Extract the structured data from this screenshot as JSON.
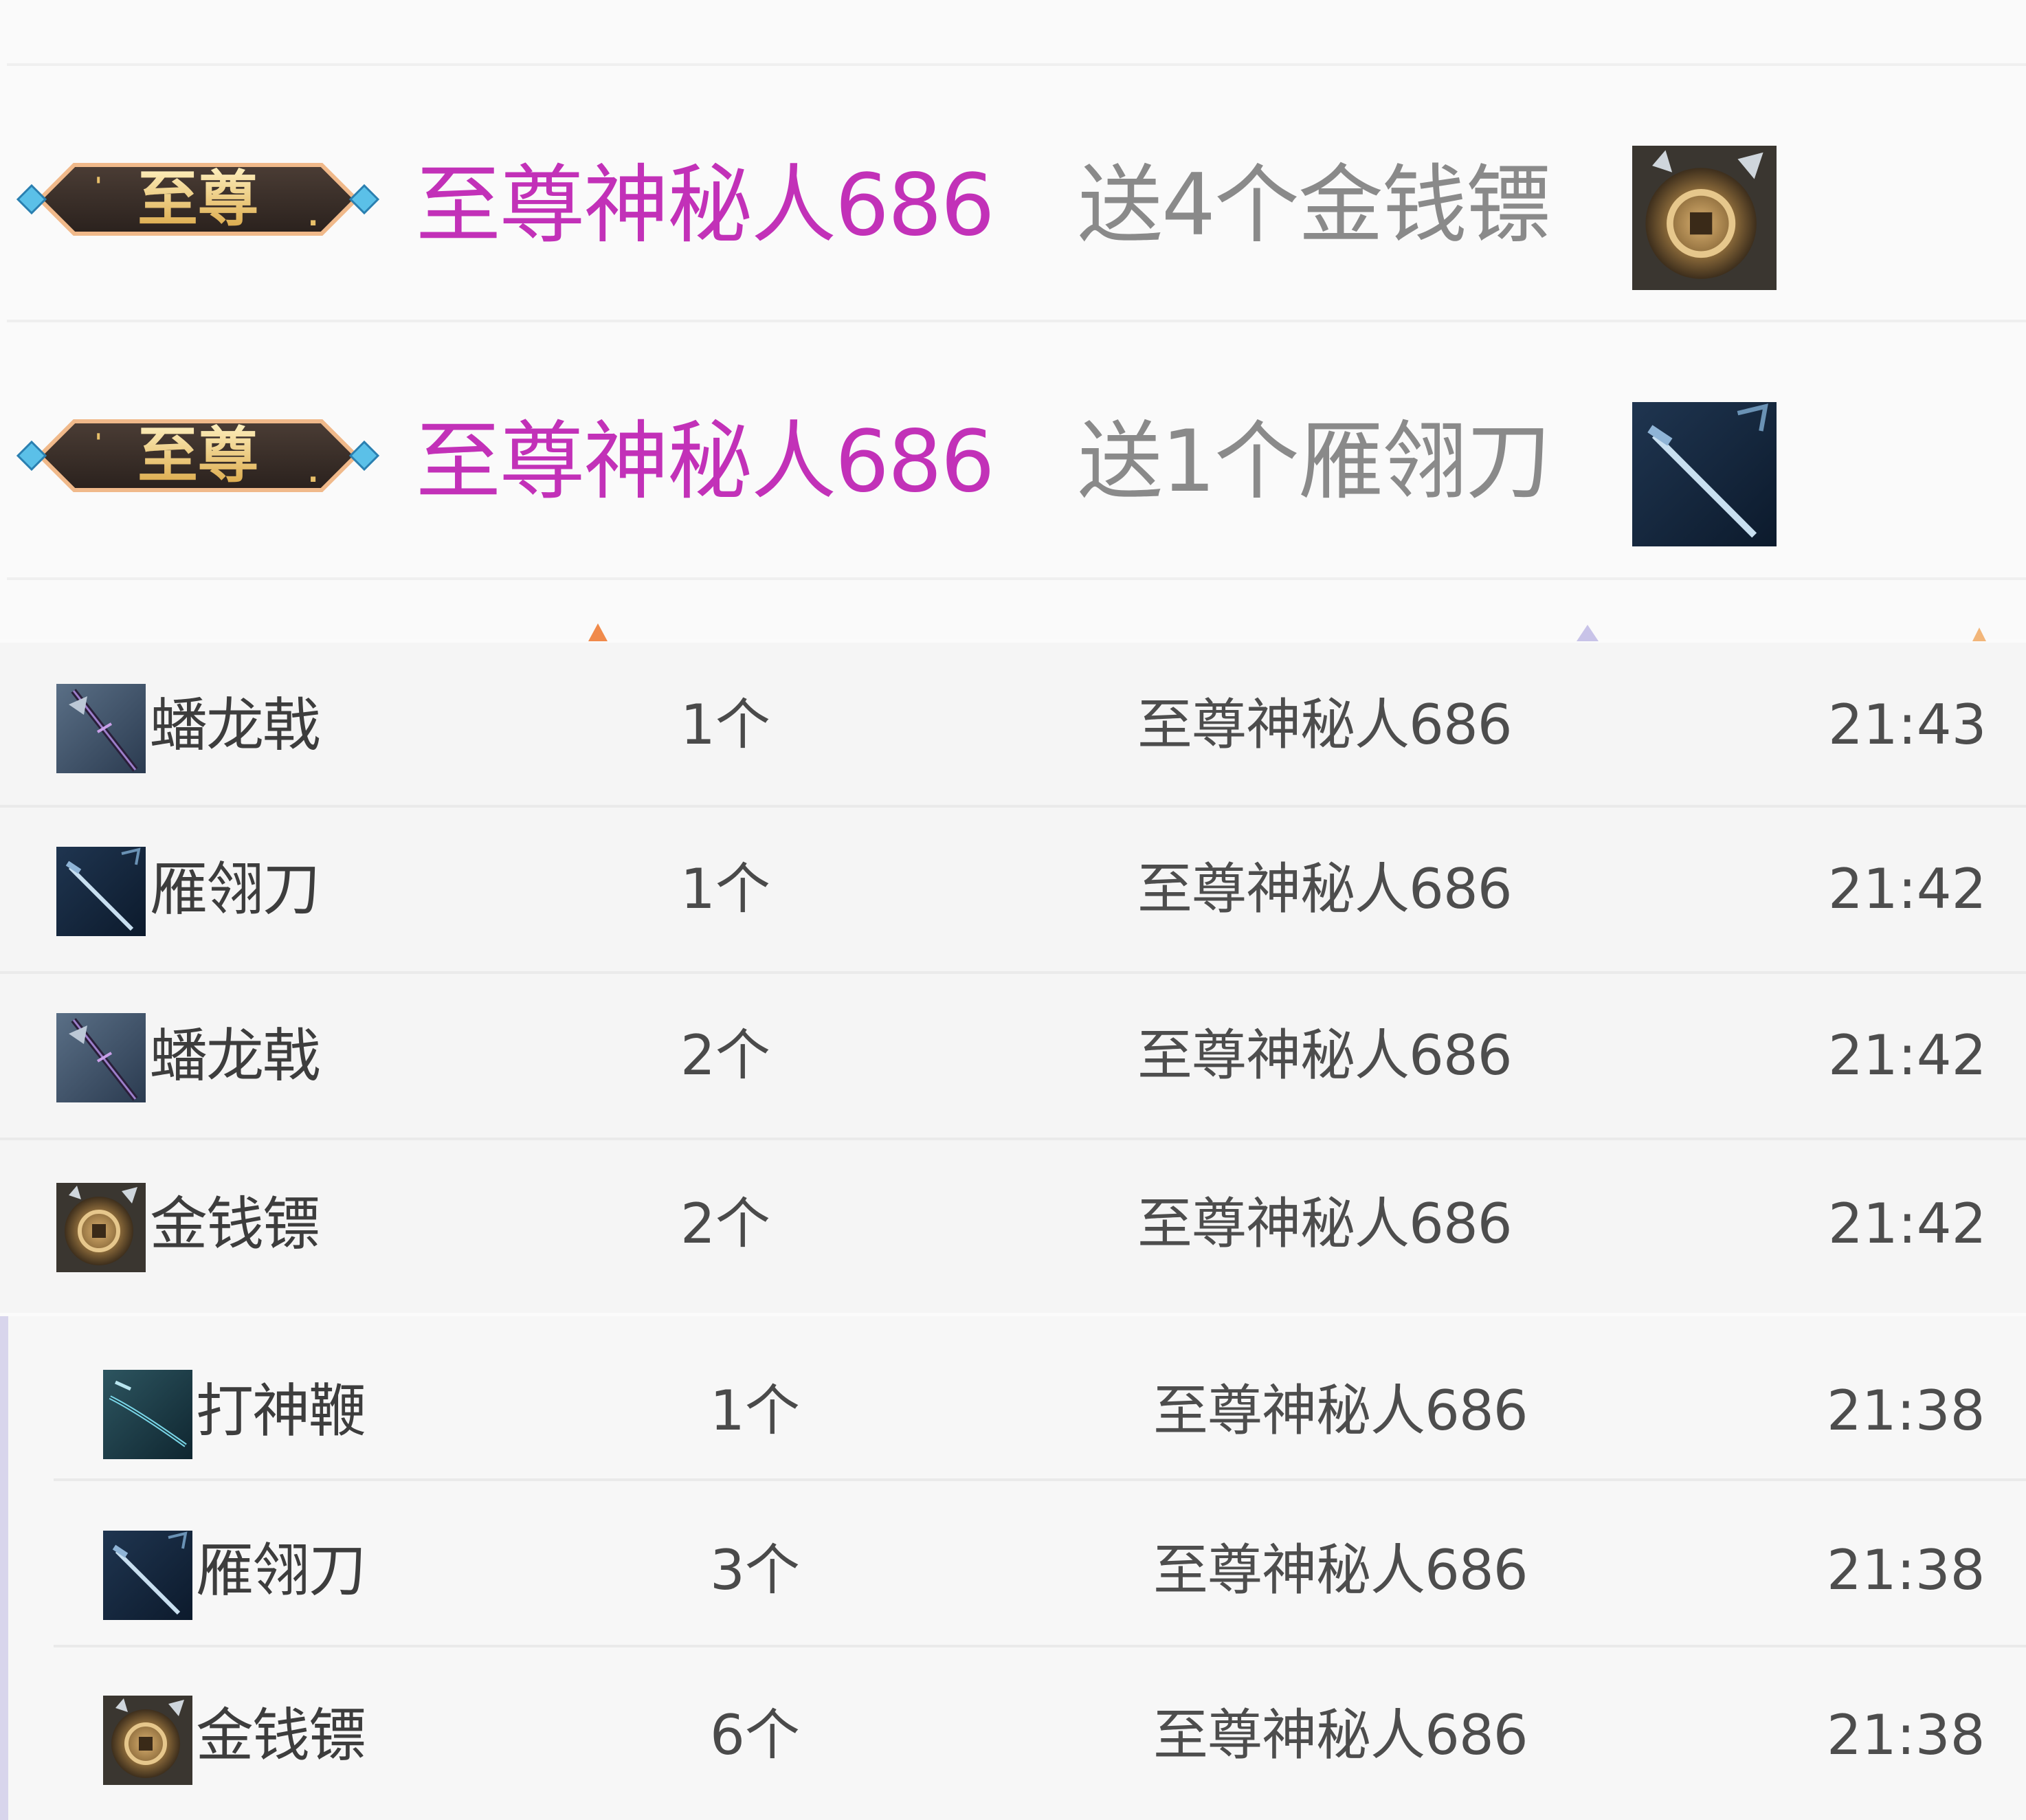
{
  "chat": {
    "messages": [
      {
        "badge": "至尊",
        "user": "至尊神秘人686",
        "action": "送4个金钱镖",
        "icon": "coin-dart-icon"
      },
      {
        "badge": "至尊",
        "user": "至尊神秘人686",
        "action": "送1个雁翎刀",
        "icon": "saber-icon"
      }
    ]
  },
  "gifts": [
    {
      "icon": "halberd-icon",
      "name": "蟠龙戟",
      "qty": "1个",
      "user": "至尊神秘人686",
      "time": "21:43"
    },
    {
      "icon": "saber-icon",
      "name": "雁翎刀",
      "qty": "1个",
      "user": "至尊神秘人686",
      "time": "21:42"
    },
    {
      "icon": "halberd-icon",
      "name": "蟠龙戟",
      "qty": "2个",
      "user": "至尊神秘人686",
      "time": "21:42"
    },
    {
      "icon": "coin-dart-icon",
      "name": "金钱镖",
      "qty": "2个",
      "user": "至尊神秘人686",
      "time": "21:42"
    },
    {
      "icon": "whip-icon",
      "name": "打神鞭",
      "qty": "1个",
      "user": "至尊神秘人686",
      "time": "21:38"
    },
    {
      "icon": "saber-icon",
      "name": "雁翎刀",
      "qty": "3个",
      "user": "至尊神秘人686",
      "time": "21:38"
    },
    {
      "icon": "coin-dart-icon",
      "name": "金钱镖",
      "qty": "6个",
      "user": "至尊神秘人686",
      "time": "21:38"
    }
  ],
  "colors": {
    "username_accent": "#c231b8",
    "badge_gold": "#e8c06a",
    "badge_dark": "#3a2e28",
    "list_accent_bar": "#d8d5ec"
  }
}
